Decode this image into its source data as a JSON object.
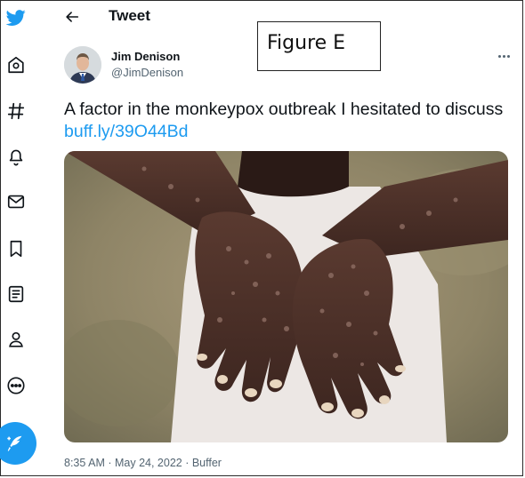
{
  "header": {
    "title": "Tweet"
  },
  "figure_label": "Figure E",
  "author": {
    "name": "Jim Denison",
    "handle": "@JimDenison"
  },
  "tweet": {
    "text": "A factor in the monkeypox outbreak I hesitated to discuss ",
    "link": "buff.ly/39O44Bd"
  },
  "meta": {
    "time": "8:35 AM",
    "separator1": " · ",
    "date": "May 24, 2022",
    "separator2": " · ",
    "source": "Buffer"
  },
  "nav": {
    "items": [
      "twitter-logo",
      "home",
      "explore",
      "notifications",
      "messages",
      "bookmarks",
      "lists",
      "profile",
      "more"
    ]
  },
  "colors": {
    "accent": "#1d9bf0",
    "text": "#0f1419",
    "muted": "#536471"
  }
}
